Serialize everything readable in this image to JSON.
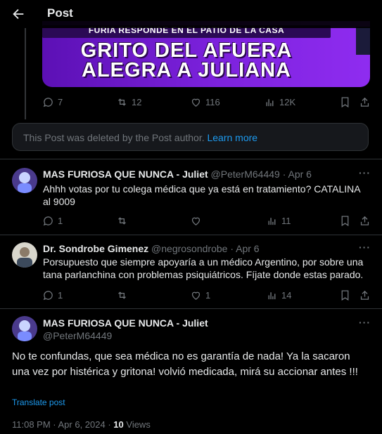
{
  "header": {
    "title": "Post"
  },
  "media": {
    "top_line": "FURIA RESPONDE EN EL PATIO DE LA CASA",
    "headline_1": "GRITO DEL AFUERA",
    "headline_2": "ALEGRA A JULIANA"
  },
  "quoted_post_actions": {
    "replies": "7",
    "reposts": "12",
    "likes": "116",
    "views": "12K"
  },
  "deleted_notice": {
    "text": "This Post was deleted by the Post author.",
    "link": "Learn more"
  },
  "replies": [
    {
      "name": "MAS FURIOSA QUE NUNCA - Juliet",
      "handle": "@PeterM64449",
      "time": "Apr 6",
      "text": "Ahhh votas por tu colega médica que ya está en tratamiento? CATALINA al 9009",
      "replies": "1",
      "reposts": "",
      "likes": "",
      "views": "11"
    },
    {
      "name": "Dr. Sondrobe Gimenez",
      "handle": "@negrosondrobe",
      "time": "Apr 6",
      "text": "Porsupuesto que siempre apoyaría a un médico Argentino, por sobre una tana parlanchina con problemas psiquiátricos. Fíjate donde estas parado.",
      "replies": "1",
      "reposts": "",
      "likes": "1",
      "views": "14"
    }
  ],
  "main_post": {
    "name": "MAS FURIOSA QUE NUNCA - Juliet",
    "handle": "@PeterM64449",
    "text": "No te confundas, que sea médica no es garantía de nada! Ya la sacaron una vez por histérica y gritona! volvió medicada, mirá su accionar antes !!!",
    "translate": "Translate post",
    "time": "11:08 PM · Apr 6, 2024 · ",
    "views_count": "10",
    "views_label": " Views"
  },
  "separators": {
    "dot": "·",
    "more": "···"
  },
  "colors": {
    "accent": "#1d9bf0",
    "muted": "#71767b",
    "text": "#e7e9ea",
    "background": "#000000"
  },
  "icons": [
    "back-arrow-icon",
    "reply-icon",
    "repost-icon",
    "like-icon",
    "views-icon",
    "bookmark-icon",
    "share-icon",
    "more-icon"
  ]
}
